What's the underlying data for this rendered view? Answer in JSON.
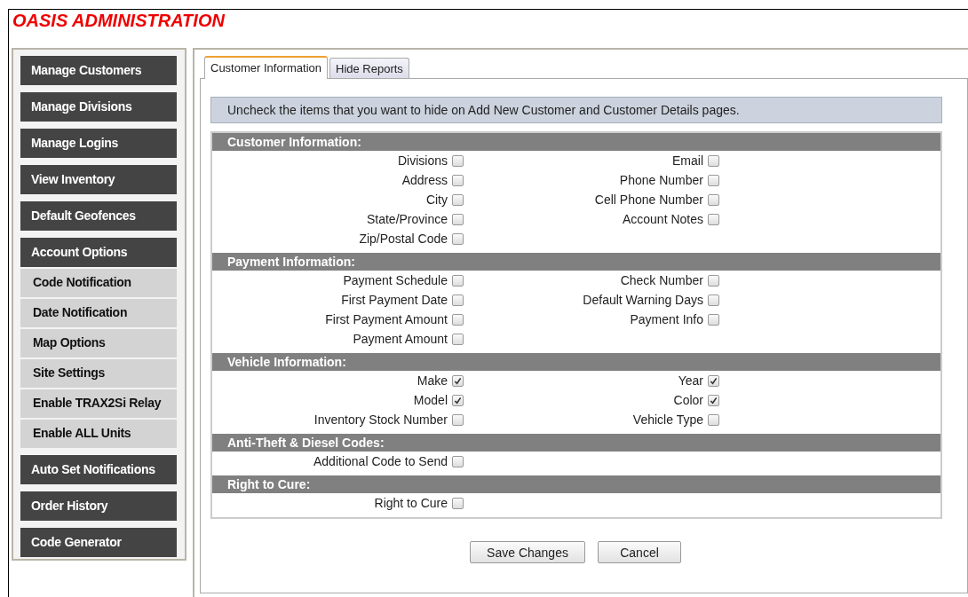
{
  "title": "OASIS ADMINISTRATION",
  "sidebar": {
    "items": [
      {
        "label": "Manage Customers",
        "kind": "main"
      },
      {
        "label": "Manage Divisions",
        "kind": "main"
      },
      {
        "label": "Manage Logins",
        "kind": "main"
      },
      {
        "label": "View Inventory",
        "kind": "main"
      },
      {
        "label": "Default Geofences",
        "kind": "main"
      },
      {
        "label": "Account Options",
        "kind": "main",
        "children": [
          {
            "label": "Code Notification"
          },
          {
            "label": "Date Notification"
          },
          {
            "label": "Map Options"
          },
          {
            "label": "Site Settings"
          },
          {
            "label": "Enable TRAX2Si Relay"
          },
          {
            "label": "Enable ALL Units"
          }
        ]
      },
      {
        "label": "Auto Set Notifications",
        "kind": "main"
      },
      {
        "label": "Order History",
        "kind": "main"
      },
      {
        "label": "Code Generator",
        "kind": "main"
      }
    ]
  },
  "tabs": [
    {
      "label": "Customer Information",
      "selected": true
    },
    {
      "label": "Hide Reports",
      "selected": false
    }
  ],
  "instructions": "Uncheck the items that you want to hide on Add New Customer and Customer Details pages.",
  "sections": [
    {
      "title": "Customer Information:",
      "rows": [
        [
          {
            "label": "Divisions",
            "checked": false
          },
          {
            "label": "Email",
            "checked": false
          }
        ],
        [
          {
            "label": "Address",
            "checked": false
          },
          {
            "label": "Phone Number",
            "checked": false
          }
        ],
        [
          {
            "label": "City",
            "checked": false
          },
          {
            "label": "Cell Phone Number",
            "checked": false
          }
        ],
        [
          {
            "label": "State/Province",
            "checked": false
          },
          {
            "label": "Account Notes",
            "checked": false
          }
        ],
        [
          {
            "label": "Zip/Postal Code",
            "checked": false
          }
        ]
      ]
    },
    {
      "title": "Payment Information:",
      "rows": [
        [
          {
            "label": "Payment Schedule",
            "checked": false
          },
          {
            "label": "Check Number",
            "checked": false
          }
        ],
        [
          {
            "label": "First Payment Date",
            "checked": false
          },
          {
            "label": "Default Warning Days",
            "checked": false
          }
        ],
        [
          {
            "label": "First Payment Amount",
            "checked": false
          },
          {
            "label": "Payment Info",
            "checked": false
          }
        ],
        [
          {
            "label": "Payment Amount",
            "checked": false
          }
        ]
      ]
    },
    {
      "title": "Vehicle Information:",
      "rows": [
        [
          {
            "label": "Make",
            "checked": true
          },
          {
            "label": "Year",
            "checked": true
          }
        ],
        [
          {
            "label": "Model",
            "checked": true
          },
          {
            "label": "Color",
            "checked": true
          }
        ],
        [
          {
            "label": "Inventory Stock Number",
            "checked": false
          },
          {
            "label": "Vehicle Type",
            "checked": false
          }
        ]
      ]
    },
    {
      "title": "Anti-Theft & Diesel Codes:",
      "rows": [
        [
          {
            "label": "Additional Code to Send",
            "checked": false
          }
        ]
      ]
    },
    {
      "title": "Right to Cure:",
      "rows": [
        [
          {
            "label": "Right to Cure",
            "checked": false
          }
        ]
      ]
    }
  ],
  "buttons": [
    "Save Changes",
    "Cancel"
  ]
}
